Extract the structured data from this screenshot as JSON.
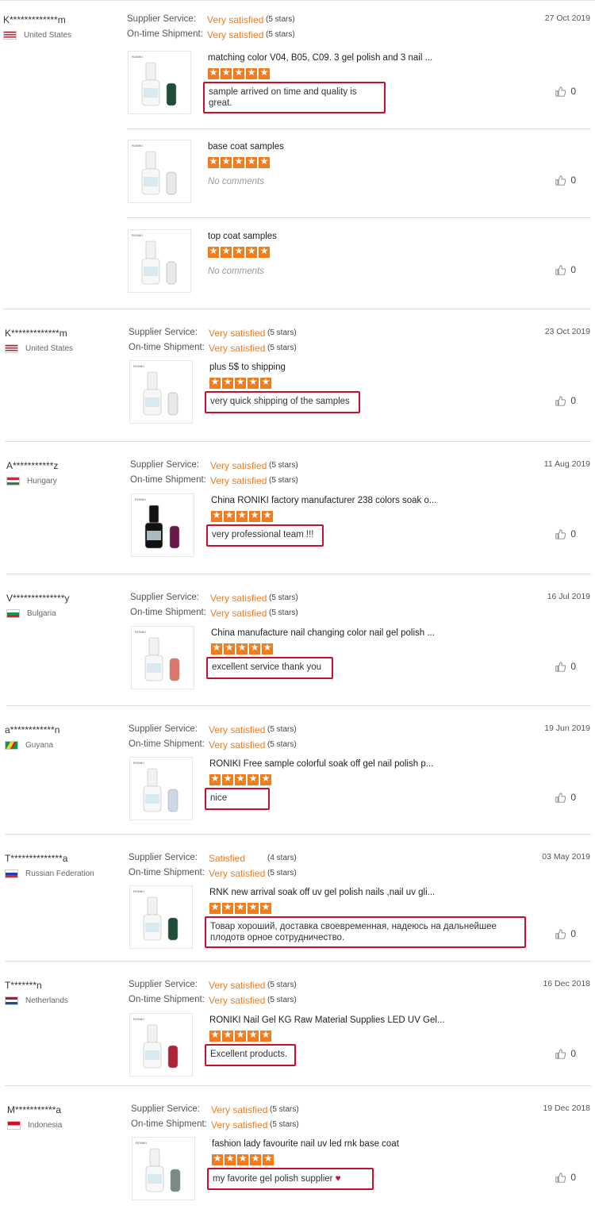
{
  "labels": {
    "supplier_service": "Supplier Service:",
    "on_time_shipment": "On-time Shipment:"
  },
  "colors": {
    "accent": "#f07c1e",
    "highlight_box": "#c8102e"
  },
  "reviews": [
    {
      "buyer": "K*************m",
      "country": "United States",
      "flag": "us-flag",
      "date": "27 Oct 2019",
      "supplier_service": "Very satisfied",
      "supplier_stars": "(5 stars)",
      "shipment": "Very satisfied",
      "shipment_stars": "(5 stars)",
      "items": [
        {
          "title": "matching color V04, B05, C09. 3 gel polish and 3 nail ...",
          "rating": 5,
          "comment": "sample arrived on time and quality is great.",
          "likes": "0"
        },
        {
          "title": "base coat samples",
          "rating": 5,
          "comment": "No comments",
          "likes": "0"
        },
        {
          "title": "top coat samples",
          "rating": 5,
          "comment": "No comments",
          "likes": "0"
        }
      ]
    },
    {
      "buyer": "K*************m",
      "country": "United States",
      "flag": "us-flag",
      "date": "23 Oct 2019",
      "supplier_service": "Very satisfied",
      "supplier_stars": "(5 stars)",
      "shipment": "Very satisfied",
      "shipment_stars": "(5 stars)",
      "items": [
        {
          "title": "plus 5$ to shipping",
          "rating": 5,
          "comment": "very quick shipping of the samples",
          "likes": "0"
        }
      ]
    },
    {
      "buyer": "A***********z",
      "country": "Hungary",
      "flag": "hungary-flag",
      "date": "11 Aug 2019",
      "supplier_service": "Very satisfied",
      "supplier_stars": "(5 stars)",
      "shipment": "Very satisfied",
      "shipment_stars": "(5 stars)",
      "items": [
        {
          "title": "China RONIKI factory manufacturer 238 colors soak o...",
          "rating": 5,
          "comment": "very professional team !!!",
          "likes": "0"
        }
      ]
    },
    {
      "buyer": "V**************y",
      "country": "Bulgaria",
      "flag": "bulgaria-flag",
      "date": "16 Jul 2019",
      "supplier_service": "Very satisfied",
      "supplier_stars": "(5 stars)",
      "shipment": "Very satisfied",
      "shipment_stars": "(5 stars)",
      "items": [
        {
          "title": "China manufacture nail changing color nail gel polish ...",
          "rating": 5,
          "comment": "excellent service  thank you",
          "likes": "0"
        }
      ]
    },
    {
      "buyer": "a************n",
      "country": "Guyana",
      "flag": "guyana-flag",
      "date": "19 Jun 2019",
      "supplier_service": "Very satisfied",
      "supplier_stars": "(5 stars)",
      "shipment": "Very satisfied",
      "shipment_stars": "(5 stars)",
      "items": [
        {
          "title": "RONIKI Free sample colorful soak off gel nail polish p...",
          "rating": 5,
          "comment": "nice",
          "likes": "0"
        }
      ]
    },
    {
      "buyer": "T**************a",
      "country": "Russian Federation",
      "flag": "russia-flag",
      "date": "03 May 2019",
      "supplier_service": "Satisfied",
      "supplier_stars": "(4 stars)",
      "shipment": "Very satisfied",
      "shipment_stars": "(5 stars)",
      "items": [
        {
          "title": "RNK new arrival soak off uv gel polish nails ,nail uv gli...",
          "rating": 5,
          "comment": "Товар хороший, доставка своевременная, надеюсь на дальнейшее плодотв орное сотрудничество.",
          "likes": "0"
        }
      ]
    },
    {
      "buyer": "T*******n",
      "country": "Netherlands",
      "flag": "netherlands-flag",
      "date": "16 Dec 2018",
      "supplier_service": "Very satisfied",
      "supplier_stars": "(5 stars)",
      "shipment": "Very satisfied",
      "shipment_stars": "(5 stars)",
      "items": [
        {
          "title": "RONIKI Nail Gel KG Raw Material Supplies LED UV Gel...",
          "rating": 5,
          "comment": "Excellent products.",
          "likes": "0"
        }
      ]
    },
    {
      "buyer": "M***********a",
      "country": "Indonesia",
      "flag": "indonesia-flag",
      "date": "19 Dec 2018",
      "supplier_service": "Very satisfied",
      "supplier_stars": "(5 stars)",
      "shipment": "Very satisfied",
      "shipment_stars": "(5 stars)",
      "items": [
        {
          "title": "fashion lady favourite nail uv led rnk base coat",
          "rating": 5,
          "comment": "my favorite gel polish supplier",
          "likes": "0"
        }
      ]
    }
  ]
}
